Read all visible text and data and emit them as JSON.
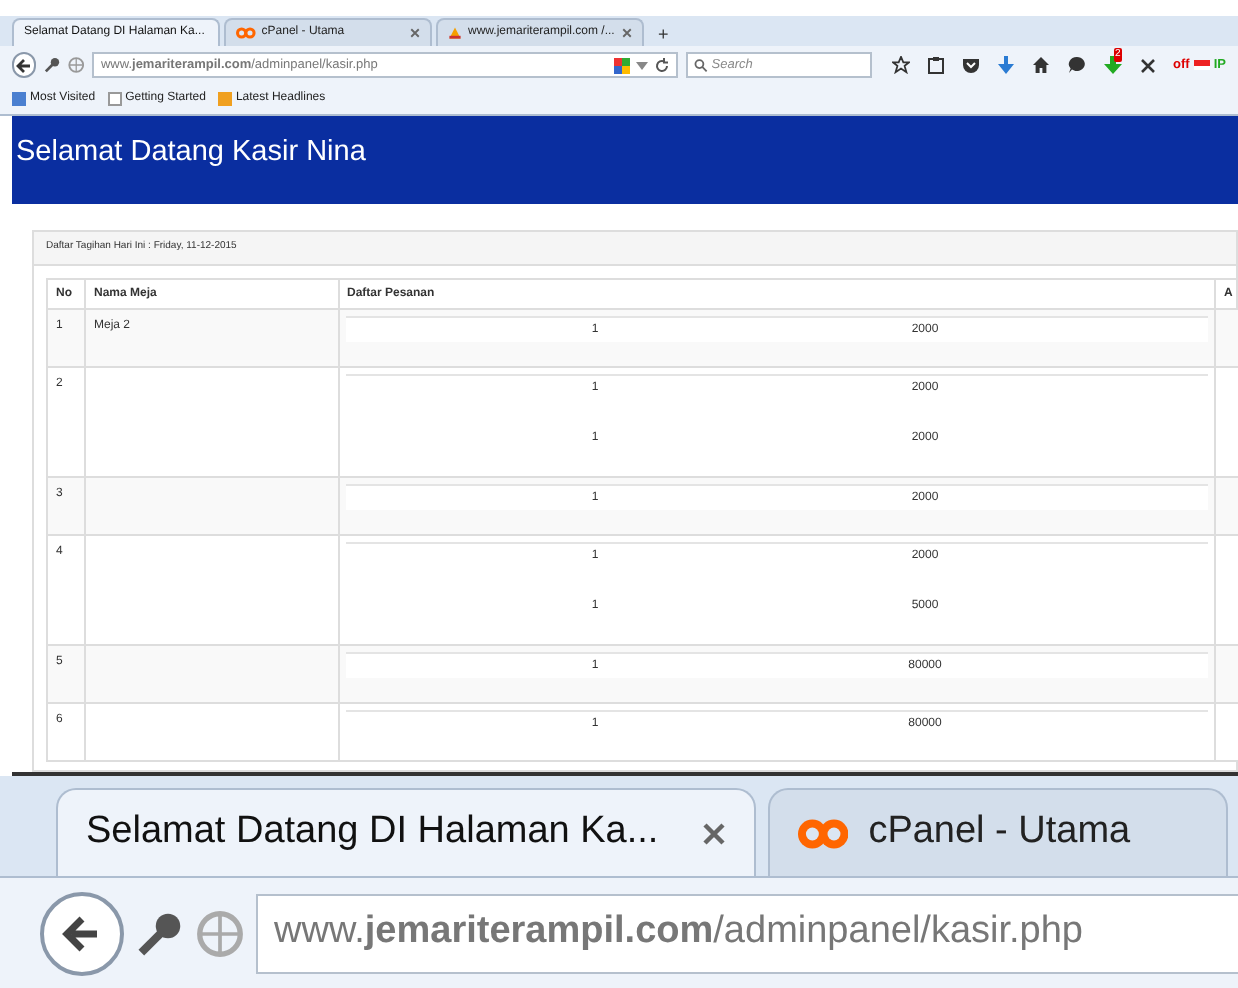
{
  "browser": {
    "tabs": [
      {
        "title": "Selamat Datang DI Halaman Ka...",
        "selected": true
      },
      {
        "title": "cPanel - Utama",
        "selected": false
      },
      {
        "title": "www.jemariterampil.com /...",
        "selected": false
      }
    ],
    "new_tab": "+",
    "url": "www.**jemariterampil.com**/adminpanel/kasir.php",
    "search": {
      "placeholder": "Search"
    },
    "download_badge": "2",
    "addon_off": "off",
    "addon_ip": "IP",
    "bookmarks": [
      "Most Visited",
      "Getting Started",
      "Latest Headlines"
    ]
  },
  "header": {
    "title": "Selamat Datang Kasir Nina"
  },
  "panel": {
    "heading": "Daftar Tagihan Hari Ini : Friday, 11-12-2015",
    "columns": [
      "No",
      "Nama Meja",
      "Daftar Pesanan",
      "A"
    ],
    "rows": [
      {
        "no": "1",
        "table": "Meja 2",
        "orders": [
          {
            "qty": "1",
            "price": "2000"
          }
        ]
      },
      {
        "no": "2",
        "table": "",
        "orders": [
          {
            "qty": "1",
            "price": "2000"
          },
          {
            "qty": "1",
            "price": "2000"
          }
        ]
      },
      {
        "no": "3",
        "table": "",
        "orders": [
          {
            "qty": "1",
            "price": "2000"
          }
        ]
      },
      {
        "no": "4",
        "table": "",
        "orders": [
          {
            "qty": "1",
            "price": "2000"
          },
          {
            "qty": "1",
            "price": "5000"
          }
        ]
      },
      {
        "no": "5",
        "table": "",
        "orders": [
          {
            "qty": "1",
            "price": "80000"
          }
        ]
      },
      {
        "no": "6",
        "table": "",
        "orders": [
          {
            "qty": "1",
            "price": "80000"
          }
        ]
      }
    ]
  },
  "zoom_inset": {
    "tabs": [
      {
        "title": "Selamat Datang DI Halaman Ka...",
        "selected": true
      },
      {
        "title": "cPanel - Utama",
        "selected": false
      }
    ],
    "url": "www.**jemariterampil.com**/adminpanel/kasir.php"
  }
}
